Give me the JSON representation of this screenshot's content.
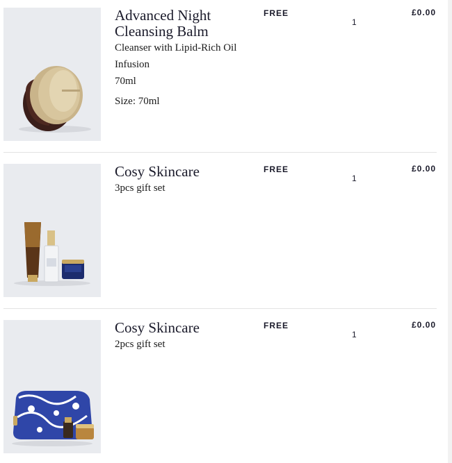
{
  "cart": {
    "items": [
      {
        "image_icon": "cleansing-balm-jar-icon",
        "name_lines": [
          "Advanced Night",
          "Cleansing Balm"
        ],
        "description_lines": [
          "Cleanser with Lipid-Rich Oil",
          "Infusion",
          "70ml"
        ],
        "size": "Size: 70ml",
        "badge": "FREE",
        "quantity": "1",
        "price": "£0.00"
      },
      {
        "image_icon": "skincare-gift-set-icon",
        "name_lines": [
          "Cosy Skincare"
        ],
        "description_lines": [
          "3pcs gift set"
        ],
        "size": "",
        "badge": "FREE",
        "quantity": "1",
        "price": "£0.00"
      },
      {
        "image_icon": "pouch-gift-set-icon",
        "name_lines": [
          "Cosy Skincare"
        ],
        "description_lines": [
          "2pcs gift set"
        ],
        "size": "",
        "badge": "FREE",
        "quantity": "1",
        "price": "£0.00"
      }
    ]
  },
  "colors": {
    "image_background": "#e9ebef",
    "divider": "#e3e3e3",
    "text": "#1a1a2a"
  }
}
